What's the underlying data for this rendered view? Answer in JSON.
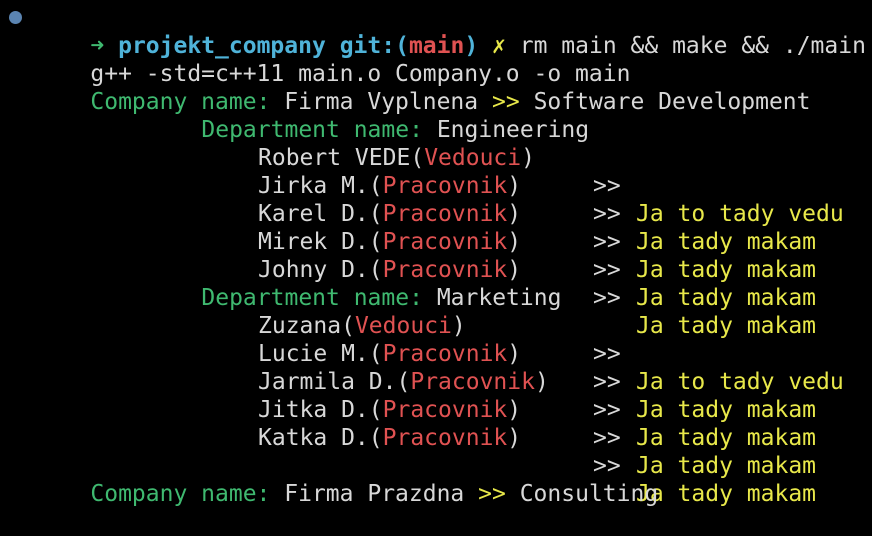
{
  "prompt": {
    "arrow": "➜",
    "dir": "projekt_company",
    "git_prefix": "git:(",
    "branch": "main",
    "git_suffix": ")",
    "dirty": "✗",
    "command": "rm main && make && ./main"
  },
  "compile_line": "g++ -std=c++11 main.o Company.o -o main",
  "companies": [
    {
      "label": "Company name:",
      "name": "Firma Vyplnena",
      "sep": ">>",
      "field": "Software Development",
      "departments": [
        {
          "label": "Department name:",
          "name": "Engineering",
          "employees": [
            {
              "name": "Robert VEDE",
              "role": "Vedouci",
              "sep": ">>",
              "msg": "Ja to tady vedu"
            },
            {
              "name": "Jirka M.",
              "role": "Pracovnik",
              "sep": ">>",
              "msg": "Ja tady makam"
            },
            {
              "name": "Karel D.",
              "role": "Pracovnik",
              "sep": ">>",
              "msg": "Ja tady makam"
            },
            {
              "name": "Mirek D.",
              "role": "Pracovnik",
              "sep": ">>",
              "msg": "Ja tady makam"
            },
            {
              "name": "Johny D.",
              "role": "Pracovnik",
              "sep": ">>",
              "msg": "Ja tady makam"
            }
          ]
        },
        {
          "label": "Department name:",
          "name": "Marketing",
          "employees": [
            {
              "name": "Zuzana",
              "role": "Vedouci",
              "sep": ">>",
              "msg": "Ja to tady vedu"
            },
            {
              "name": "Lucie M.",
              "role": "Pracovnik",
              "sep": ">>",
              "msg": "Ja tady makam"
            },
            {
              "name": "Jarmila D.",
              "role": "Pracovnik",
              "sep": ">>",
              "msg": "Ja tady makam"
            },
            {
              "name": "Jitka D.",
              "role": "Pracovnik",
              "sep": ">>",
              "msg": "Ja tady makam"
            },
            {
              "name": "Katka D.",
              "role": "Pracovnik",
              "sep": ">>",
              "msg": "Ja tady makam"
            }
          ]
        }
      ]
    },
    {
      "label": "Company name:",
      "name": "Firma Prazdna",
      "sep": ">>",
      "field": "Consulting",
      "departments": []
    }
  ],
  "colors": {
    "background": "#000000",
    "label_green": "#3fb970",
    "text_white": "#d8d8d8",
    "msg_yellow": "#e8e84a",
    "role_red": "#e05252",
    "dir_cyan": "#4fb3d9",
    "dot_blue": "#5b84b1"
  }
}
